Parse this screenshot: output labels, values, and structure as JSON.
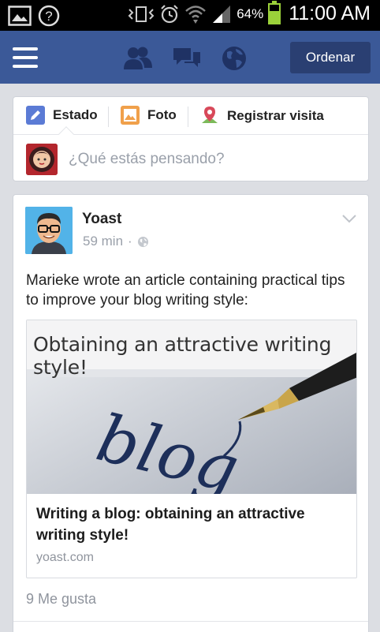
{
  "status_bar": {
    "battery_percent": "64%",
    "battery_level": 0.64,
    "time": "11:00 AM",
    "icons": [
      "gallery-icon",
      "help-icon",
      "vibrate-icon",
      "alarm-icon",
      "wifi-icon",
      "signal-icon",
      "battery-icon"
    ],
    "colors": {
      "battery": "#9bd13a"
    }
  },
  "app_bar": {
    "color": "#3b5998",
    "nav_icons": [
      "menu-icon",
      "friend-requests-icon",
      "messages-icon",
      "notifications-globe-icon"
    ],
    "order_button_label": "Ordenar"
  },
  "composer": {
    "tabs": [
      {
        "label": "Estado",
        "icon": "pencil-icon"
      },
      {
        "label": "Foto",
        "icon": "photo-icon"
      },
      {
        "label": "Registrar visita",
        "icon": "location-pin-icon"
      }
    ],
    "placeholder": "¿Qué estás pensando?"
  },
  "post": {
    "author": "Yoast",
    "time": "59 min",
    "separator": "·",
    "privacy_icon": "globe-icon",
    "text": "Marieke wrote an article containing practical tips to improve your blog writing style:",
    "link": {
      "image_caption": "Obtaining an attractive writing style!",
      "image_word": "blog",
      "title": "Writing a blog: obtaining an attractive writing style!",
      "domain": "yoast.com"
    },
    "likes": "9 Me gusta"
  }
}
